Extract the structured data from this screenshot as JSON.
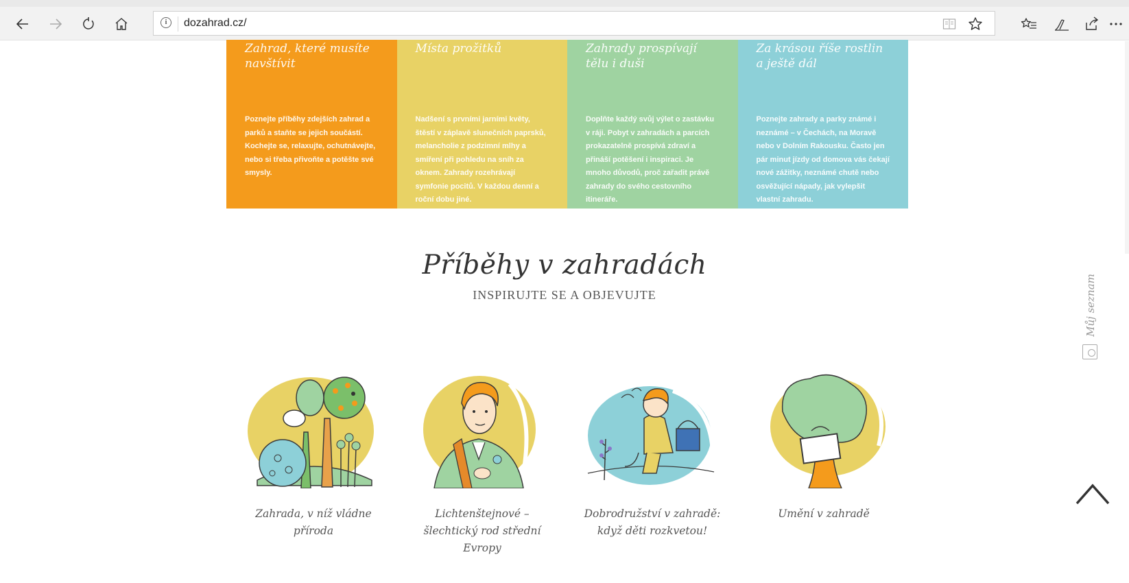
{
  "browser": {
    "url": "dozahrad.cz/",
    "icons": [
      "back-icon",
      "forward-icon",
      "refresh-icon",
      "home-icon",
      "info-icon",
      "reading-view-icon",
      "favorite-star-icon",
      "favorites-list-icon",
      "pen-icon",
      "share-icon",
      "more-icon"
    ]
  },
  "cards": [
    {
      "title": "Zahrad, které musíte navštívit",
      "text": "Poznejte příběhy zdejších zahrad a parků a staňte se jejich součástí. Kochejte se, relaxujte, ochutnávejte, nebo si třeba přivoňte a potěšte své smysly.",
      "color": "#f49b1c"
    },
    {
      "title": "Místa prožitků",
      "text": "Nadšení s prvními jarními květy, štěstí v záplavě slunečních paprsků, melancholie z podzimní mlhy a smíření při pohledu na sníh za oknem. Zahrady rozehrávají symfonie pocitů. V každou denní a roční dobu jiné.",
      "color": "#e8d265"
    },
    {
      "title": "Zahrady prospívají tělu i duši",
      "text": "Doplňte každý svůj výlet o zastávku v ráji. Pobyt v zahradách a parcích prokazatelně prospívá zdraví a přináší potěšení i inspiraci. Je mnoho důvodů, proč zařadit právě zahrady do svého cestovního itineráře.",
      "color": "#9fd3a1"
    },
    {
      "title": "Za krásou říše rostlin a ještě dál",
      "text": "Poznejte zahrady a parky známé i neznámé – v Čechách, na Moravě nebo v Dolním Rakousku. Často jen pár minut jízdy od domova vás čekají nové zážitky, neznámé chutě nebo osvěžující nápady, jak vylepšit vlastní zahradu.",
      "color": "#8dd0d8"
    }
  ],
  "section": {
    "title": "Příběhy v zahradách",
    "subtitle": "INSPIRUJTE SE A OBJEVUJTE"
  },
  "stories": [
    "Zahrada, v níž vládne příroda",
    "Lichtenštejnové – šlechtický rod střední Evropy",
    "Dobrodružství v zahradě: když děti rozkvetou!",
    "Umění v zahradě"
  ],
  "sidebar": {
    "my_list_label": "Můj seznam"
  },
  "colors": {
    "accent_orange": "#f49b1c",
    "accent_yellow": "#e8d265",
    "accent_green": "#9fd3a1",
    "accent_teal": "#8dd0d8"
  }
}
